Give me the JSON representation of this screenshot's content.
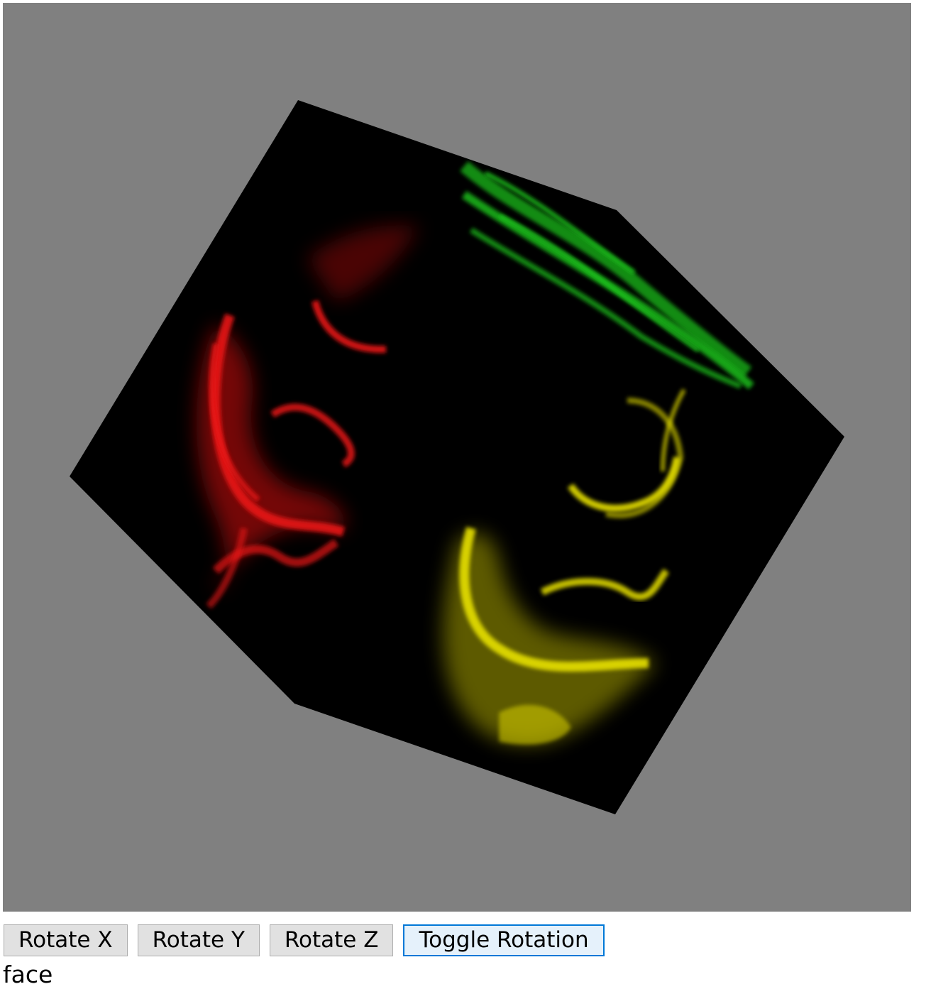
{
  "scene": {
    "background_color": "#808080",
    "cube_color": "#000000",
    "faces": [
      {
        "name": "left-face",
        "tint": "red",
        "color": "#e01010"
      },
      {
        "name": "top-face",
        "tint": "green",
        "color": "#16c016"
      },
      {
        "name": "right-face",
        "tint": "yellow",
        "color": "#e6e000"
      }
    ]
  },
  "controls": {
    "rotate_x_label": "Rotate X",
    "rotate_y_label": "Rotate Y",
    "rotate_z_label": "Rotate Z",
    "toggle_rotation_label": "Toggle Rotation"
  },
  "status": {
    "face_text": "face"
  }
}
